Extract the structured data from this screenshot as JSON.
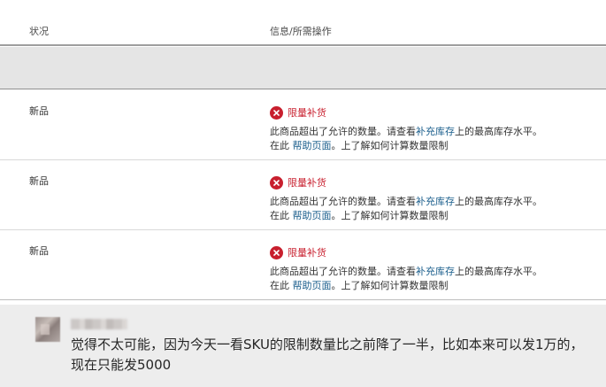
{
  "table": {
    "header": {
      "status": "状况",
      "info": "信息/所需操作"
    },
    "rows": [
      {
        "status": "新品",
        "alert_title": "限量补货",
        "msg_pre": "此商品超出了允许的数量。请查看",
        "msg_link": "补充库存",
        "msg_post": "上的最高库存水平。",
        "line2_pre": "在此 ",
        "line2_link": "帮助页面",
        "line2_post": "。上了解如何计算数量限制"
      },
      {
        "status": "新品",
        "alert_title": "限量补货",
        "msg_pre": "此商品超出了允许的数量。请查看",
        "msg_link": "补充库存",
        "msg_post": "上的最高库存水平。",
        "line2_pre": "在此 ",
        "line2_link": "帮助页面",
        "line2_post": "。上了解如何计算数量限制"
      },
      {
        "status": "新品",
        "alert_title": "限量补货",
        "msg_pre": "此商品超出了允许的数量。请查看",
        "msg_link": "补充库存",
        "msg_post": "上的最高库存水平。",
        "line2_pre": "在此 ",
        "line2_link": "帮助页面",
        "line2_post": "。上了解如何计算数量限制"
      }
    ]
  },
  "comment": {
    "text": "觉得不太可能，因为今天一看SKU的限制数量比之前降了一半，比如本来可以发1万的，现在只能发5000"
  },
  "icons": {
    "alert": "error-x-circle-icon",
    "avatar": "blurred-avatar"
  },
  "colors": {
    "alert_red": "#c81f2e",
    "link_blue": "#1a5e8c",
    "band_gray": "#e5e5e5",
    "comment_bg": "#ededed"
  }
}
